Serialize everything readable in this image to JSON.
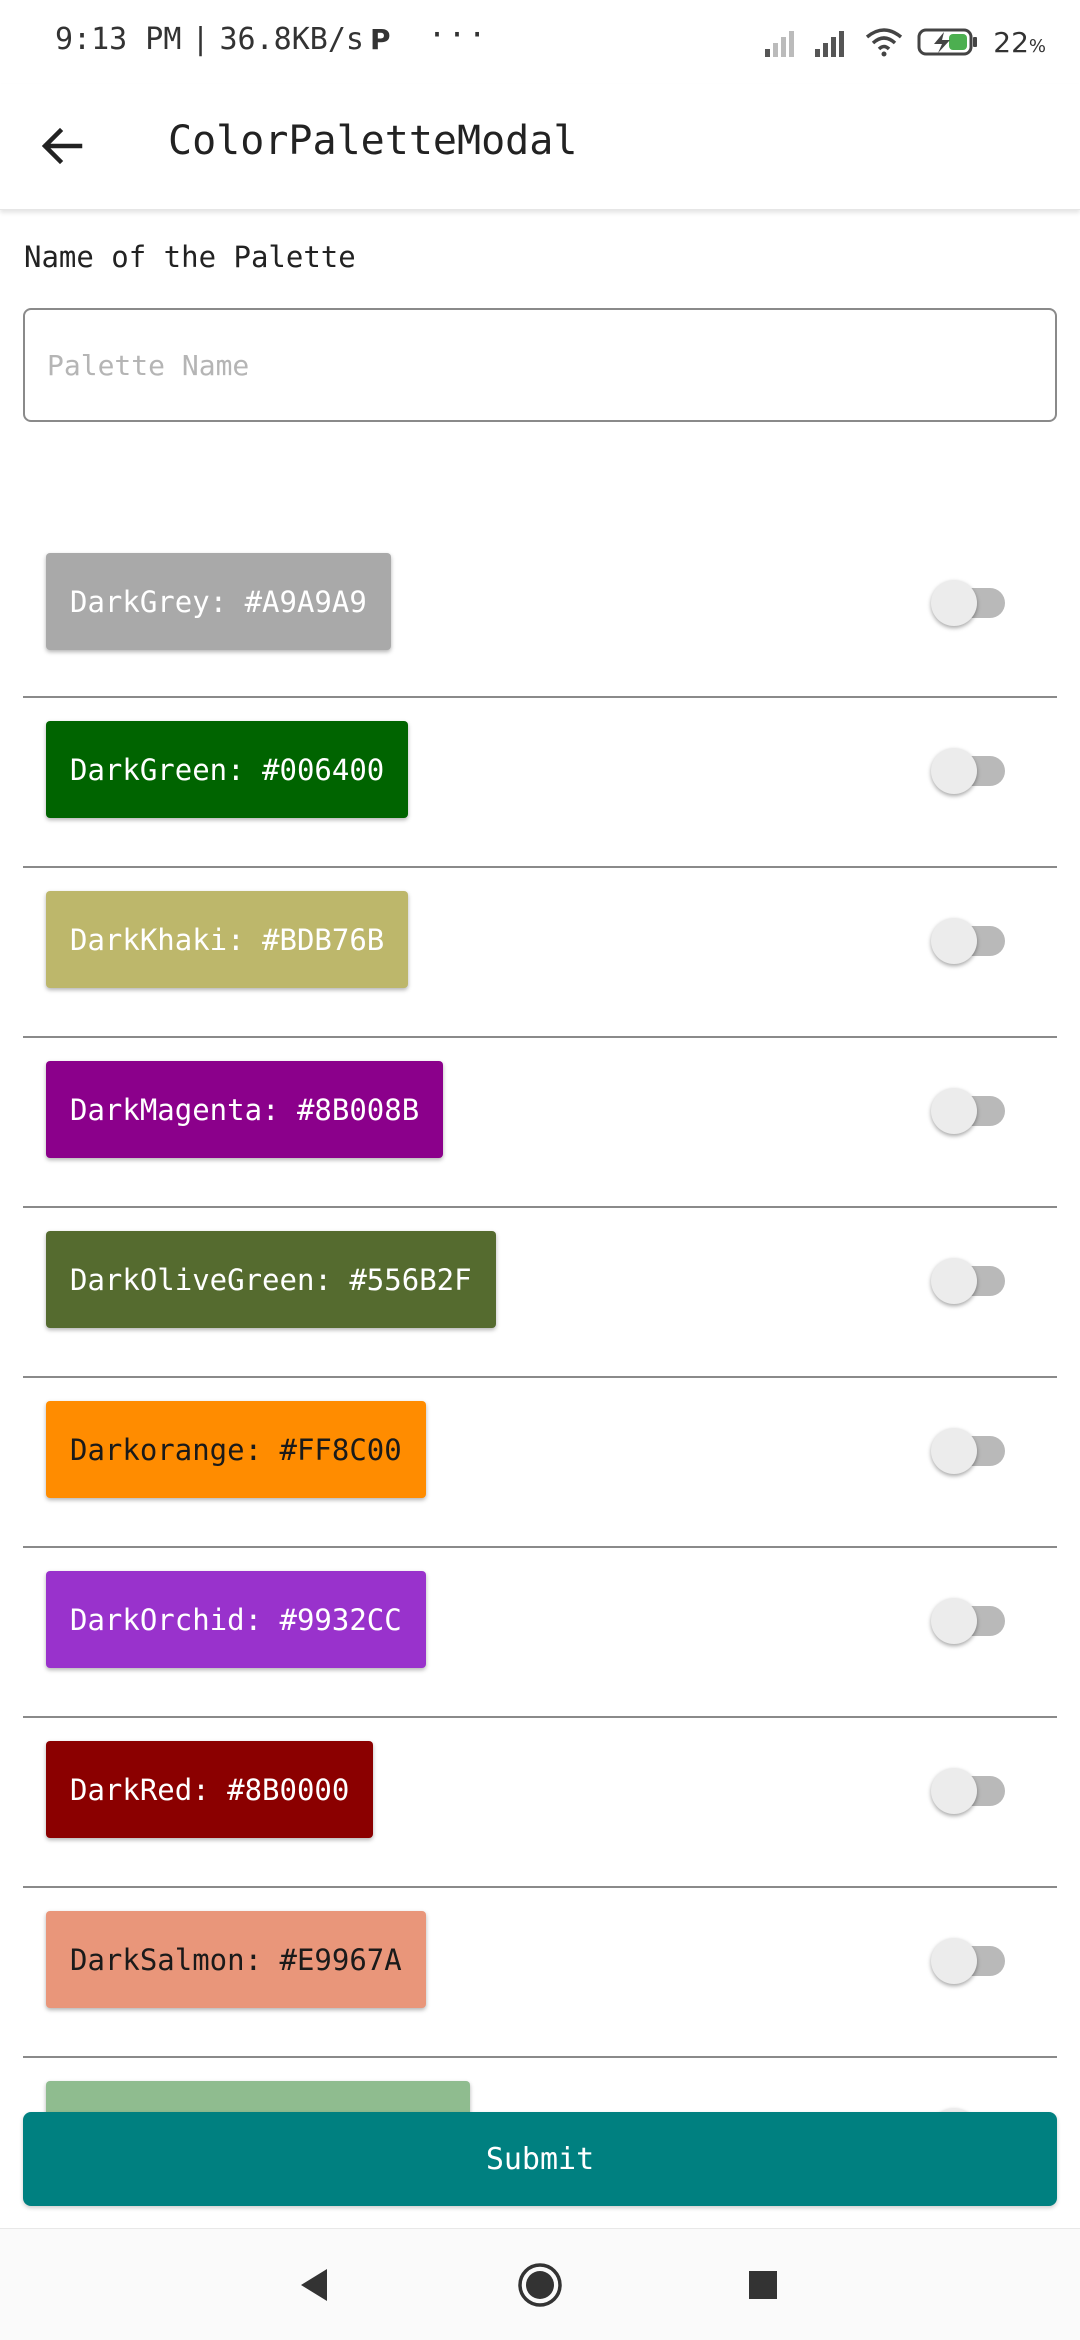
{
  "status_bar": {
    "time": "9:13 PM",
    "separator": "|",
    "network_speed": "36.8KB/s",
    "p_icon": "P",
    "more_dots": "···",
    "battery_percent": "22",
    "battery_unit": "%",
    "icons": [
      "signal-icon",
      "signal-icon",
      "wifi-icon",
      "battery-charging-icon"
    ]
  },
  "app_bar": {
    "back_icon": "arrow-left-icon",
    "title": "ColorPaletteModal"
  },
  "form": {
    "label": "Name of the Palette",
    "input_value": "",
    "input_placeholder": "Palette Name"
  },
  "colors": [
    {
      "label": "DarkGrey: #A9A9A9",
      "hex": "#A9A9A9",
      "text_color": "#ffffff",
      "enabled": false
    },
    {
      "label": "DarkGreen: #006400",
      "hex": "#006400",
      "text_color": "#ffffff",
      "enabled": false
    },
    {
      "label": "DarkKhaki: #BDB76B",
      "hex": "#BDB76B",
      "text_color": "#ffffff",
      "enabled": false
    },
    {
      "label": "DarkMagenta: #8B008B",
      "hex": "#8B008B",
      "text_color": "#ffffff",
      "enabled": false
    },
    {
      "label": "DarkOliveGreen: #556B2F",
      "hex": "#556B2F",
      "text_color": "#ffffff",
      "enabled": false
    },
    {
      "label": "Darkorange: #FF8C00",
      "hex": "#FF8C00",
      "text_color": "#1a1a1a",
      "enabled": false
    },
    {
      "label": "DarkOrchid: #9932CC",
      "hex": "#9932CC",
      "text_color": "#ffffff",
      "enabled": false
    },
    {
      "label": "DarkRed: #8B0000",
      "hex": "#8B0000",
      "text_color": "#ffffff",
      "enabled": false
    },
    {
      "label": "DarkSalmon: #E9967A",
      "hex": "#E9967A",
      "text_color": "#1a1a1a",
      "enabled": false
    },
    {
      "label": "",
      "hex": "#8FBC8F",
      "text_color": "#1a1a1a",
      "enabled": false
    }
  ],
  "submit": {
    "label": "Submit",
    "color": "#008080"
  },
  "nav_bar": {
    "icons": [
      "back-triangle-icon",
      "home-circle-icon",
      "recents-square-icon"
    ]
  }
}
